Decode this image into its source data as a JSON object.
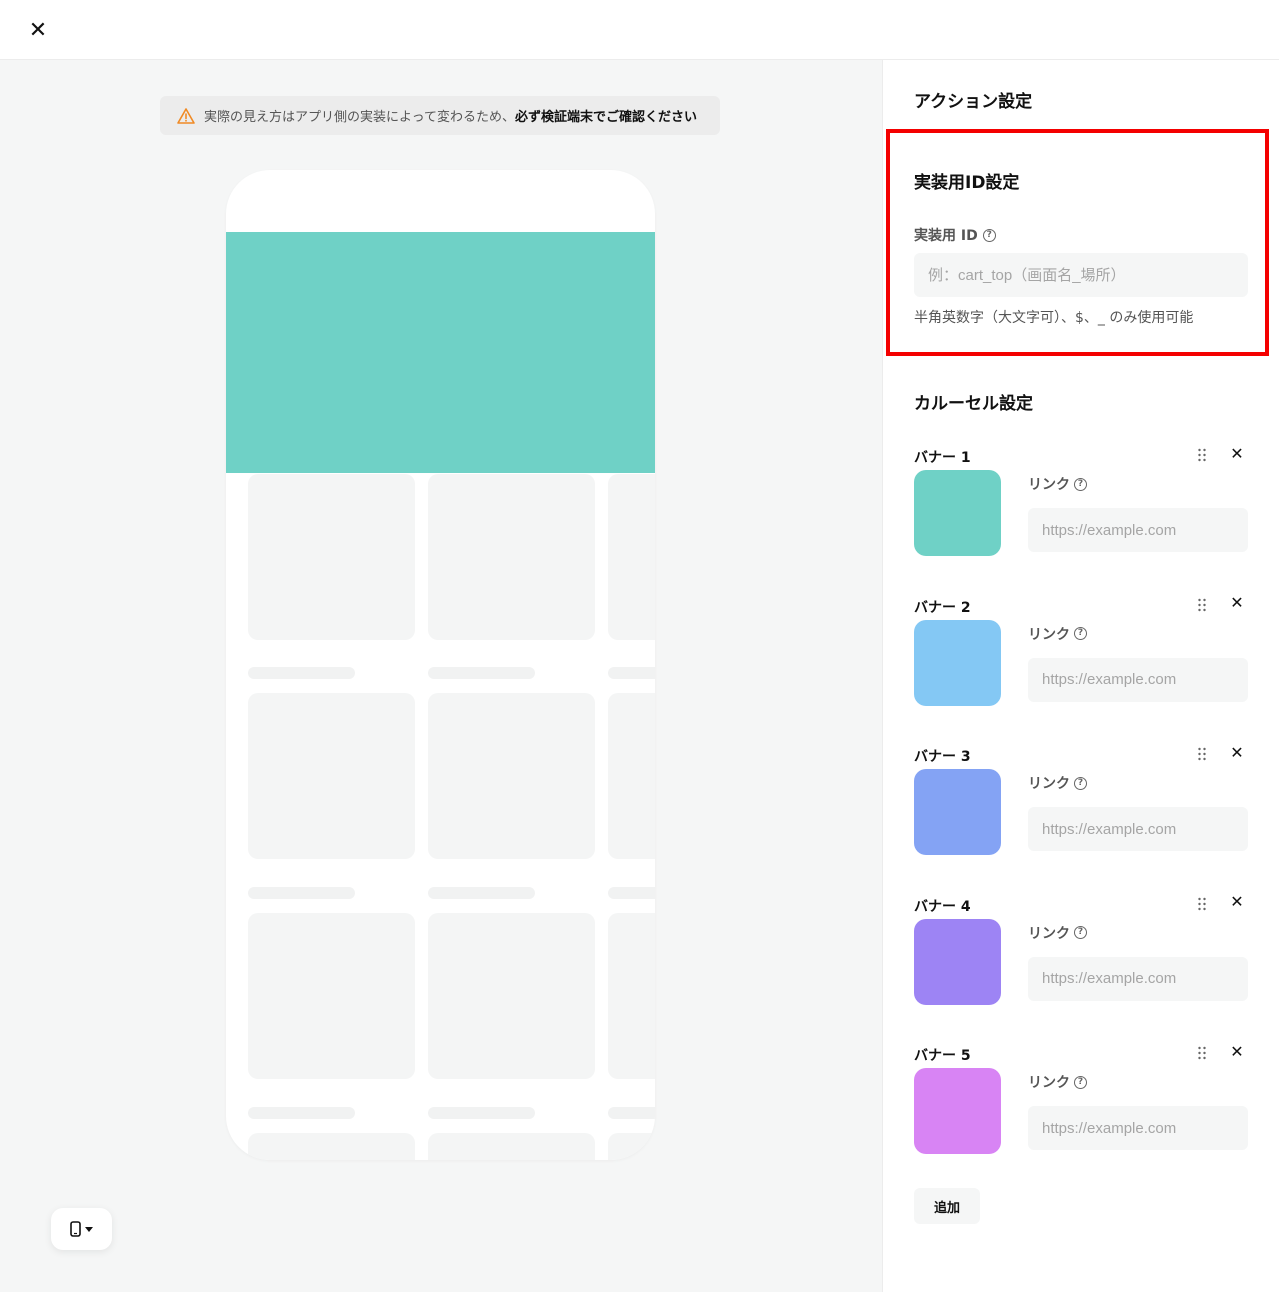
{
  "notice": {
    "text": "実際の見え方はアプリ側の実装によって変わるため、",
    "emphasis": "必ず検証端末でご確認ください"
  },
  "phone": {
    "banner_color": "#6fd1c6"
  },
  "panel": {
    "action_title": "アクション設定",
    "impl_title": "実装用ID設定",
    "impl_label": "実装用 ID",
    "impl_placeholder": "例：cart_top（画面名_場所）",
    "impl_hint": "半角英数字（大文字可）、$、_ のみ使用可能",
    "carousel_title": "カルーセル設定",
    "add_label": "追加"
  },
  "banners": [
    {
      "label": "バナー 1",
      "link_label": "リンク",
      "placeholder": "https://example.com",
      "color": "#6fd1c6"
    },
    {
      "label": "バナー 2",
      "link_label": "リンク",
      "placeholder": "https://example.com",
      "color": "#84c8f4"
    },
    {
      "label": "バナー 3",
      "link_label": "リンク",
      "placeholder": "https://example.com",
      "color": "#84a3f4"
    },
    {
      "label": "バナー 4",
      "link_label": "リンク",
      "placeholder": "https://example.com",
      "color": "#9d84f4"
    },
    {
      "label": "バナー 5",
      "link_label": "リンク",
      "placeholder": "https://example.com",
      "color": "#d884f4"
    }
  ],
  "icons": {
    "close": "close-icon",
    "warning": "warning-icon",
    "help": "help-icon",
    "drag": "drag-handle-icon",
    "device": "phone-icon",
    "dropdown": "caret-down-icon"
  }
}
